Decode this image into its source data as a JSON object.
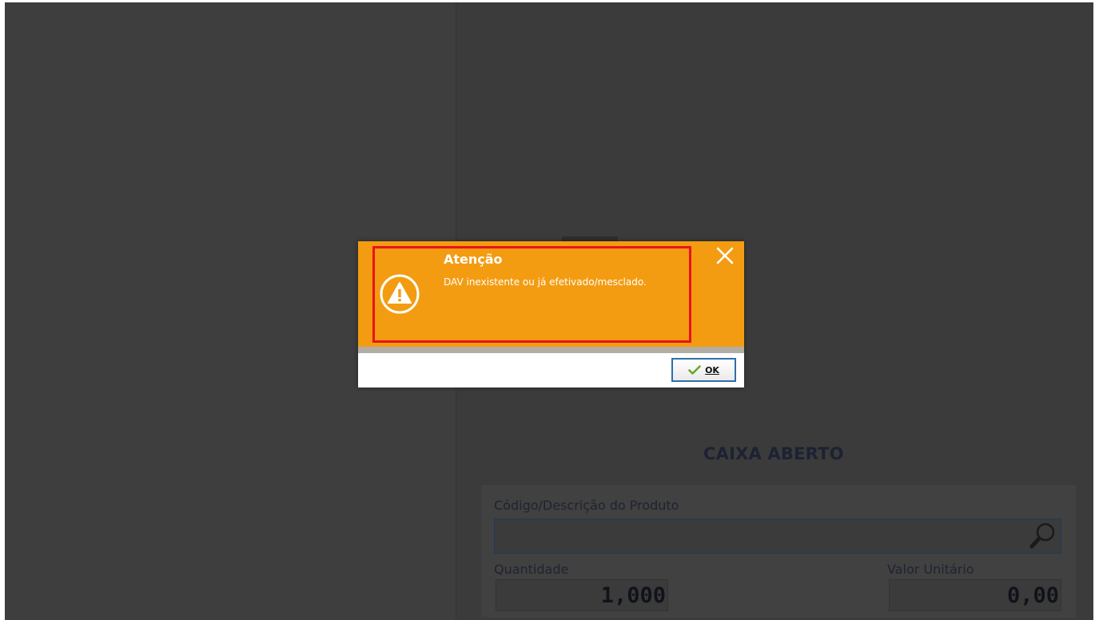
{
  "app": {
    "status_title": "CAIXA ABERTO",
    "product": {
      "search_label": "Código/Descrição do Produto",
      "search_value": "",
      "quantity_label": "Quantidade",
      "quantity_value": "1,000",
      "unit_price_label": "Valor Unitário",
      "unit_price_value": "0,00"
    }
  },
  "dialog": {
    "title": "Atenção",
    "message": "DAV inexistente ou já efetivado/mesclado.",
    "ok_label": "OK",
    "icons": {
      "warning": "warning-icon",
      "close": "close-icon",
      "ok": "checkmark-icon",
      "search": "magnifier-icon"
    },
    "colors": {
      "header": "#f39c12",
      "highlight": "#e8141a",
      "overlay": "#3d3d3d"
    }
  }
}
